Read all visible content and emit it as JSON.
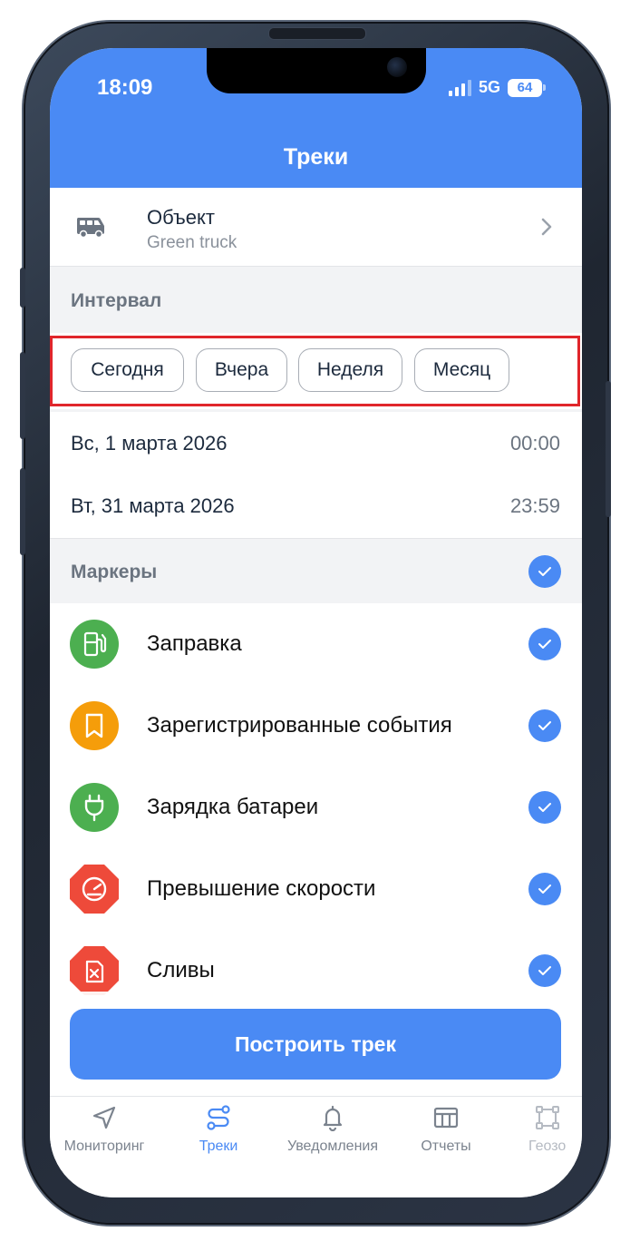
{
  "status_bar": {
    "time": "18:09",
    "network": "5G",
    "battery": "64"
  },
  "header": {
    "title": "Треки"
  },
  "object": {
    "label": "Объект",
    "value": "Green truck"
  },
  "interval": {
    "section_label": "Интервал",
    "chips": [
      "Сегодня",
      "Вчера",
      "Неделя",
      "Месяц"
    ]
  },
  "dates": {
    "start": {
      "date": "Вс, 1 марта 2026",
      "time": "00:00"
    },
    "end": {
      "date": "Вт, 31 марта 2026",
      "time": "23:59"
    }
  },
  "markers": {
    "section_label": "Маркеры",
    "all_checked": true,
    "items": [
      {
        "label": "Заправка",
        "icon": "fuel-icon",
        "color": "#4caf50",
        "checked": true
      },
      {
        "label": "Зарегистрированные события",
        "icon": "bookmark-icon",
        "color": "#f59d0a",
        "checked": true
      },
      {
        "label": "Зарядка батареи",
        "icon": "plug-icon",
        "color": "#4caf50",
        "checked": true
      },
      {
        "label": "Превышение скорости",
        "icon": "speedometer-icon",
        "color": "#ee4a3a",
        "checked": true
      },
      {
        "label": "Сливы",
        "icon": "fuel-drain-icon",
        "color": "#ee4a3a",
        "checked": true
      }
    ]
  },
  "build_button": {
    "label": "Построить трек"
  },
  "tabbar": {
    "tabs": [
      {
        "label": "Мониторинг",
        "icon": "navigation-arrow-icon",
        "active": false
      },
      {
        "label": "Треки",
        "icon": "route-icon",
        "active": true
      },
      {
        "label": "Уведомления",
        "icon": "bell-icon",
        "active": false
      },
      {
        "label": "Отчеты",
        "icon": "table-icon",
        "active": false
      },
      {
        "label": "Геозо",
        "icon": "geofence-icon",
        "active": false
      }
    ]
  },
  "colors": {
    "accent": "#4a8af4",
    "highlight": "#e0262b"
  }
}
